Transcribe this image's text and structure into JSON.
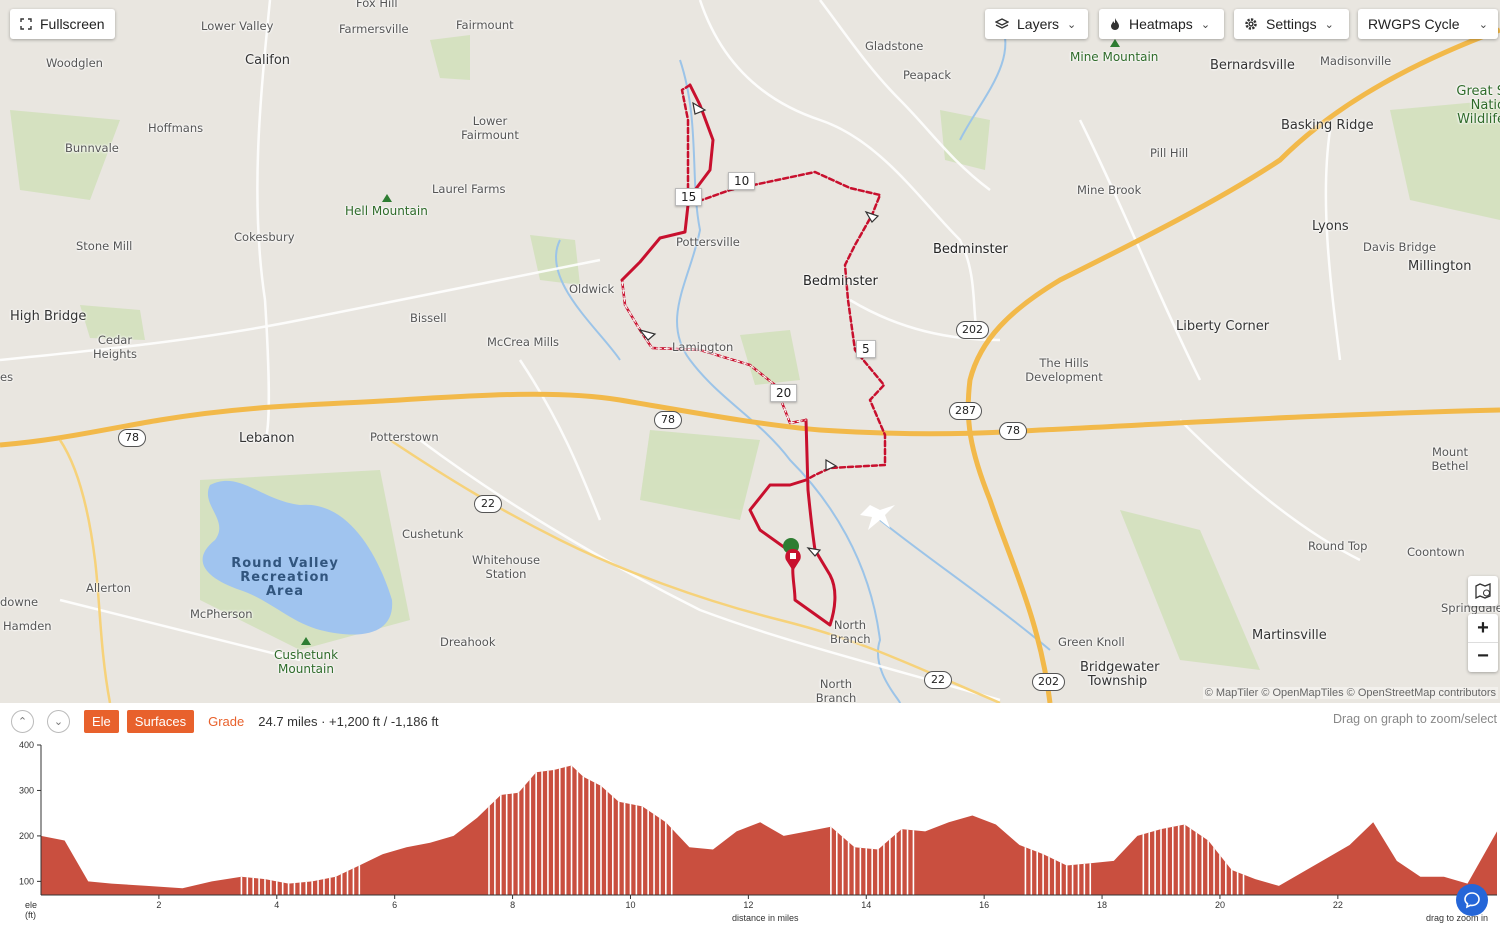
{
  "controls": {
    "fullscreen": "Fullscreen",
    "layers": "Layers",
    "heatmaps": "Heatmaps",
    "settings": "Settings",
    "map_style": "RWGPS Cycle",
    "zoom_in": "+",
    "zoom_out": "−"
  },
  "map": {
    "attribution": "© MapTiler © OpenMapTiles © OpenStreetMap contributors",
    "places": {
      "fox_hill": "Fox Hill",
      "lower_valley": "Lower Valley",
      "farmersville": "Farmersville",
      "fairmount": "Fairmount",
      "califon": "Califon",
      "woodglen": "Woodglen",
      "hoffmans": "Hoffmans",
      "bunnvale": "Bunnvale",
      "lower_fairmount": "Lower Fairmount",
      "laurel_farms": "Laurel Farms",
      "hell_mountain": "Hell Mountain",
      "cokesbury": "Cokesbury",
      "stone_mill": "Stone Mill",
      "oldwick": "Oldwick",
      "high_bridge": "High Bridge",
      "cedar_heights": "Cedar Heights",
      "bissell": "Bissell",
      "mccrea_mills": "McCrea Mills",
      "pottersville": "Pottersville",
      "lamington": "Lamington",
      "lebanon": "Lebanon",
      "potterstown": "Potterstown",
      "cushetunk": "Cushetunk",
      "whitehouse_station": "Whitehouse Station",
      "round_valley": "Round Valley Recreation Area",
      "allerton": "Allerton",
      "mcpherson": "McPherson",
      "hamden": "Hamden",
      "lansdowne": "downe",
      "dreahook": "Dreahook",
      "cushetunk_mountain": "Cushetunk Mountain",
      "gladstone": "Gladstone",
      "peapack": "Peapack",
      "mine_mountain": "Mine Mountain",
      "bernardsville": "Bernardsville",
      "madisonville": "Madisonville",
      "great_swamp": "Great S Natio Wildlife",
      "basking_ridge": "Basking Ridge",
      "pill_hill": "Pill Hill",
      "mine_brook": "Mine Brook",
      "bedminster": "Bedminster",
      "bedminster2": "Bedminster",
      "lyons": "Lyons",
      "davis_bridge": "Davis Bridge",
      "millington": "Millington",
      "liberty_corner": "Liberty Corner",
      "hills_development": "The Hills Development",
      "mount_bethel": "Mount Bethel",
      "round_top": "Round Top",
      "coontown": "Coontown",
      "springdale": "Springdale",
      "martinsville": "Martinsville",
      "green_knoll": "Green Knoll",
      "bridgewater": "Bridgewater Township",
      "north_branch": "North Branch",
      "north_branch_depot": "North Branch Depot",
      "es": "es"
    },
    "shields": [
      "78",
      "78",
      "78",
      "78",
      "22",
      "22",
      "202",
      "202",
      "287"
    ],
    "route_markers": [
      "5",
      "10",
      "15",
      "20"
    ]
  },
  "elevation": {
    "btn_ele": "Ele",
    "btn_surfaces": "Surfaces",
    "btn_grade": "Grade",
    "summary": "24.7 miles · +1,200 ft / -1,186 ft",
    "hint": "Drag on graph to zoom/select",
    "y_axis_label": "ele",
    "y_axis_unit": "(ft)",
    "x_axis_label": "distance in miles",
    "zoom_hint": "drag to zoom in",
    "fill_color": "#c94f3f"
  },
  "chart_data": {
    "type": "area",
    "xlabel": "distance in miles",
    "ylabel": "ele (ft)",
    "xlim": [
      0,
      24.7
    ],
    "ylim": [
      70,
      400
    ],
    "yticks": [
      100,
      200,
      300,
      400
    ],
    "xticks": [
      2,
      4,
      6,
      8,
      10,
      12,
      14,
      16,
      18,
      20,
      22
    ],
    "x": [
      0,
      0.4,
      0.8,
      1.2,
      1.8,
      2.4,
      2.9,
      3.4,
      3.8,
      4.2,
      4.6,
      5.0,
      5.4,
      5.8,
      6.2,
      6.6,
      7.0,
      7.4,
      7.8,
      8.1,
      8.4,
      8.7,
      9.0,
      9.2,
      9.5,
      9.8,
      10.2,
      10.6,
      11.0,
      11.4,
      11.8,
      12.2,
      12.6,
      13.0,
      13.4,
      13.8,
      14.2,
      14.6,
      15.0,
      15.4,
      15.8,
      16.2,
      16.6,
      17.0,
      17.4,
      17.8,
      18.2,
      18.6,
      19.0,
      19.4,
      19.8,
      20.2,
      20.6,
      21.0,
      21.4,
      21.8,
      22.2,
      22.6,
      23.0,
      23.4,
      23.8,
      24.2,
      24.7
    ],
    "values": [
      200,
      190,
      100,
      95,
      90,
      85,
      100,
      110,
      105,
      95,
      100,
      110,
      135,
      160,
      175,
      185,
      200,
      240,
      290,
      295,
      340,
      345,
      355,
      330,
      310,
      275,
      265,
      230,
      175,
      170,
      210,
      230,
      200,
      210,
      220,
      175,
      170,
      215,
      210,
      230,
      245,
      225,
      180,
      160,
      135,
      140,
      145,
      200,
      215,
      225,
      190,
      125,
      105,
      90,
      120,
      150,
      180,
      230,
      145,
      110,
      110,
      95,
      210
    ],
    "series": []
  }
}
